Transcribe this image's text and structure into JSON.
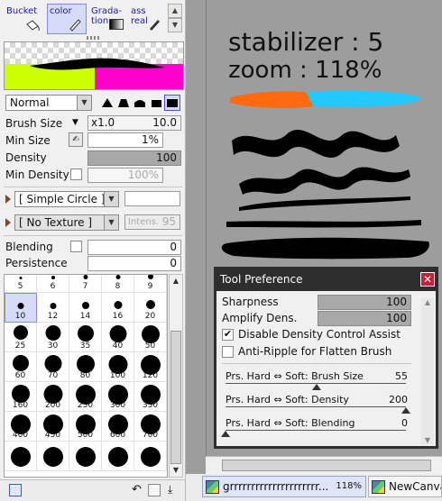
{
  "tools": [
    {
      "label": "Bucket",
      "icon": "bucket-icon",
      "selected": false
    },
    {
      "label": "color",
      "icon": "pen-icon",
      "selected": true
    },
    {
      "label": "Grada-\ntion",
      "icon": "gradient-icon",
      "selected": false
    },
    {
      "label": "ass\nreal",
      "icon": "pencil-icon",
      "selected": false
    }
  ],
  "preview": {
    "swatch_colors": [
      "#ccff00",
      "#ff00cc"
    ]
  },
  "blend_mode": "Normal",
  "brush_size": {
    "label": "Brush Size",
    "multiplier": "x1.0",
    "value": "10.0"
  },
  "min_size": {
    "label": "Min Size",
    "value": "1%"
  },
  "density": {
    "label": "Density",
    "value": "100",
    "level": 1.0
  },
  "min_density": {
    "label": "Min Density",
    "value": "100%"
  },
  "brush_shape": "[ Simple Circle ]",
  "texture": {
    "value": "[ No Texture ]",
    "intens_label": "Intens.",
    "intens_value": "95"
  },
  "blending": {
    "label": "Blending",
    "value": "0"
  },
  "persistence": {
    "label": "Persistence",
    "value": "0"
  },
  "size_rows": [
    [
      "5",
      "6",
      "7",
      "8",
      "9"
    ],
    [
      "10",
      "12",
      "14",
      "16",
      "20"
    ],
    [
      "25",
      "30",
      "35",
      "40",
      "50"
    ],
    [
      "60",
      "70",
      "80",
      "100",
      "120"
    ],
    [
      "160",
      "200",
      "250",
      "300",
      "350"
    ],
    [
      "400",
      "450",
      "500",
      "600",
      "700"
    ],
    [
      "",
      "",
      "",
      "",
      ""
    ]
  ],
  "selected_size": "10",
  "tool_preference": {
    "title": "Tool Preference",
    "sharpness": {
      "label": "Sharpness",
      "value": "100"
    },
    "amplify": {
      "label": "Amplify Dens.",
      "value": "100"
    },
    "disable_density": {
      "label": "Disable Density Control Assist",
      "checked": true
    },
    "anti_ripple": {
      "label": "Anti-Ripple for Flatten Brush",
      "checked": false
    },
    "prs_size": {
      "label": "Prs. Hard ⇔ Soft: Brush Size",
      "value": "55"
    },
    "prs_density": {
      "label": "Prs. Hard ⇔ Soft: Density",
      "value": "200"
    },
    "prs_blending": {
      "label": "Prs. Hard ⇔ Soft: Blending",
      "value": "0"
    }
  },
  "canvas_text": {
    "line1": "stabilizer : 5",
    "line2": "zoom : 118%"
  },
  "stroke_colors": {
    "orange": "#ff6a10",
    "cyan": "#22c8ff",
    "ink": "#000000"
  },
  "tabs": [
    {
      "label": "grrrrrrrrrrrrrrrrrrrrr...",
      "zoom": "118%"
    },
    {
      "label": "NewCanvas"
    }
  ]
}
